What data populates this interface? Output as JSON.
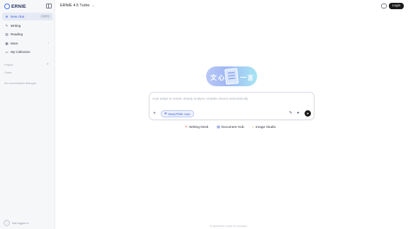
{
  "brand": {
    "name": "ERNIE",
    "logo_icon": "ernie-logo-icon"
  },
  "sidebar": {
    "collapse_icon": "sidebar-toggle-icon",
    "items": [
      {
        "label": "New chat",
        "icon": "new-chat-icon",
        "shortcut": "Ctrl+K",
        "active": true
      },
      {
        "label": "Writing",
        "icon": "pen-icon"
      },
      {
        "label": "Reading",
        "icon": "book-icon"
      },
      {
        "label": "More",
        "icon": "grid-icon"
      },
      {
        "label": "My Collection",
        "icon": "collection-icon"
      }
    ],
    "project_label": "Project",
    "chats_label": "Chats",
    "empty_text": "No conversation dialogue",
    "user_text": "Not logged in"
  },
  "header": {
    "model": "ERNIE 4.5 Turbo",
    "login_label": "Login"
  },
  "composer": {
    "placeholder": "Auto adapt to needs, deeply analyze complex issues automatically",
    "deepthink_label": "DeepThink·Auto",
    "hero_glyphs": [
      "文",
      "心",
      "一",
      "言"
    ]
  },
  "quick_actions": [
    {
      "label": "Writing Desk",
      "icon": "brush-icon"
    },
    {
      "label": "Document Hub",
      "icon": "document-icon"
    },
    {
      "label": "Image Studio",
      "icon": "palette-icon"
    }
  ],
  "footer": {
    "note": "AI-generated, check for accuracy"
  },
  "colors": {
    "accent": "#3b5bd9",
    "login_bg": "#1a1a1a",
    "sidebar_bg": "#f6f7f9"
  }
}
